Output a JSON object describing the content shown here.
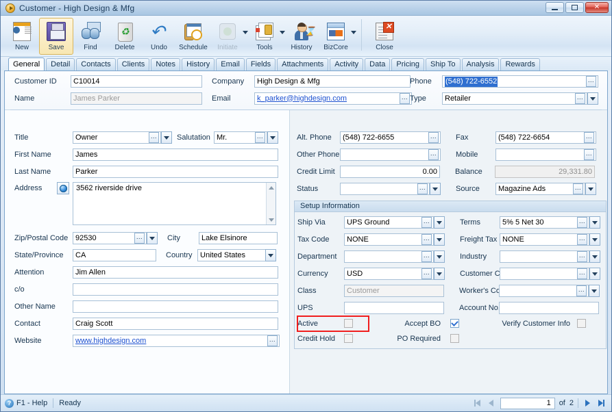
{
  "window": {
    "title": "Customer - High Design & Mfg",
    "icon": "play-circle-icon",
    "buttons": {
      "minimize": "minimize-icon",
      "maximize": "maximize-icon",
      "close": "close-icon"
    }
  },
  "toolbar": {
    "items": [
      {
        "label": "New",
        "icon": "new-record-icon",
        "disabled": false,
        "active": false,
        "dropdown": false
      },
      {
        "label": "Save",
        "icon": "save-floppy-icon",
        "disabled": false,
        "active": true,
        "dropdown": false
      },
      {
        "label": "Find",
        "icon": "find-binoculars-icon",
        "disabled": false,
        "active": false,
        "dropdown": false
      },
      {
        "label": "Delete",
        "icon": "delete-recycle-icon",
        "disabled": false,
        "active": false,
        "dropdown": false
      },
      {
        "label": "Undo",
        "icon": "undo-arrow-icon",
        "disabled": false,
        "active": false,
        "dropdown": false
      },
      {
        "label": "Schedule",
        "icon": "schedule-calendar-icon",
        "disabled": false,
        "active": false,
        "dropdown": false
      },
      {
        "label": "Initiate",
        "icon": "initiate-icon",
        "disabled": true,
        "active": false,
        "dropdown": true
      },
      {
        "label": "Tools",
        "icon": "tools-wrench-icon",
        "disabled": false,
        "active": false,
        "dropdown": true
      },
      {
        "label": "History",
        "icon": "history-person-icon",
        "disabled": false,
        "active": false,
        "dropdown": false
      },
      {
        "label": "BizCore",
        "icon": "bizcore-window-icon",
        "disabled": false,
        "active": false,
        "dropdown": true
      },
      {
        "label": "Close",
        "icon": "close-document-icon",
        "disabled": false,
        "active": false,
        "dropdown": false
      }
    ]
  },
  "tabs": {
    "selected": "General",
    "items": [
      "General",
      "Detail",
      "Contacts",
      "Clients",
      "Notes",
      "History",
      "Email",
      "Fields",
      "Attachments",
      "Activity",
      "Data",
      "Pricing",
      "Ship To",
      "Analysis",
      "Rewards"
    ]
  },
  "header": {
    "customer_id": {
      "label": "Customer ID",
      "value": "C10014"
    },
    "name": {
      "label": "Name",
      "value": "James  Parker"
    },
    "company": {
      "label": "Company",
      "value": "High Design & Mfg"
    },
    "email": {
      "label": "Email",
      "value": "k_parker@highdesign.com"
    },
    "phone": {
      "label": "Phone",
      "value": "(548) 722-6552",
      "selected": true
    },
    "type": {
      "label": "Type",
      "value": "Retailer"
    }
  },
  "left": {
    "title": {
      "label": "Title",
      "value": "Owner"
    },
    "salutation": {
      "label": "Salutation",
      "value": "Mr."
    },
    "first_name": {
      "label": "First Name",
      "value": "James"
    },
    "last_name": {
      "label": "Last Name",
      "value": "Parker"
    },
    "address": {
      "label": "Address",
      "value": "3562 riverside drive",
      "icon": "globe-icon"
    },
    "zip": {
      "label": "Zip/Postal Code",
      "value": "92530"
    },
    "city": {
      "label": "City",
      "value": "Lake Elsinore"
    },
    "state": {
      "label": "State/Province",
      "value": "CA"
    },
    "country": {
      "label": "Country",
      "value": "United States"
    },
    "attention": {
      "label": "Attention",
      "value": "Jim Allen"
    },
    "co": {
      "label": "c/o",
      "value": ""
    },
    "other_name": {
      "label": "Other Name",
      "value": ""
    },
    "contact": {
      "label": "Contact",
      "value": "Craig Scott"
    },
    "website": {
      "label": "Website",
      "value": "www.highdesign.com"
    }
  },
  "right": {
    "alt_phone": {
      "label": "Alt. Phone",
      "value": "(548) 722-6655"
    },
    "fax": {
      "label": "Fax",
      "value": "(548) 722-6654"
    },
    "other_phone": {
      "label": "Other Phone",
      "value": ""
    },
    "mobile": {
      "label": "Mobile",
      "value": ""
    },
    "credit_limit": {
      "label": "Credit Limit",
      "value": "0.00"
    },
    "balance": {
      "label": "Balance",
      "value": "29,331.80"
    },
    "status": {
      "label": "Status",
      "value": ""
    },
    "source": {
      "label": "Source",
      "value": "Magazine Ads"
    }
  },
  "setup": {
    "title": "Setup Information",
    "ship_via": {
      "label": "Ship Via",
      "value": "UPS Ground"
    },
    "terms": {
      "label": "Terms",
      "value": "5% 5 Net 30"
    },
    "tax_code": {
      "label": "Tax Code",
      "value": "NONE"
    },
    "freight_tax": {
      "label": "Freight Tax",
      "value": "NONE"
    },
    "department": {
      "label": "Department",
      "value": ""
    },
    "industry": {
      "label": "Industry",
      "value": ""
    },
    "currency": {
      "label": "Currency",
      "value": "USD"
    },
    "customer_code": {
      "label": "Customer Code",
      "value": ""
    },
    "class": {
      "label": "Class",
      "value": "Customer"
    },
    "workers_code": {
      "label": "Worker's Code",
      "value": ""
    },
    "ups": {
      "label": "UPS",
      "value": ""
    },
    "account_no": {
      "label": "Account No.",
      "value": ""
    },
    "active": {
      "label": "Active",
      "checked": false,
      "highlighted": true
    },
    "accept_bo": {
      "label": "Accept BO",
      "checked": true
    },
    "verify_customer_info": {
      "label": "Verify Customer Info",
      "checked": false
    },
    "credit_hold": {
      "label": "Credit Hold",
      "checked": false
    },
    "po_required": {
      "label": "PO Required",
      "checked": false
    }
  },
  "statusbar": {
    "help": "F1 - Help",
    "status": "Ready",
    "page": "1",
    "of": "of",
    "total": "2",
    "first_icon": "first-record-icon",
    "prev_icon": "previous-record-icon",
    "next_icon": "next-record-icon",
    "last_icon": "last-record-icon"
  },
  "colors": {
    "accent": "#2f6fd0",
    "highlight_box": "#f01d1d",
    "titlebar": "#b9d1e9",
    "link": "#1a4fd0"
  }
}
